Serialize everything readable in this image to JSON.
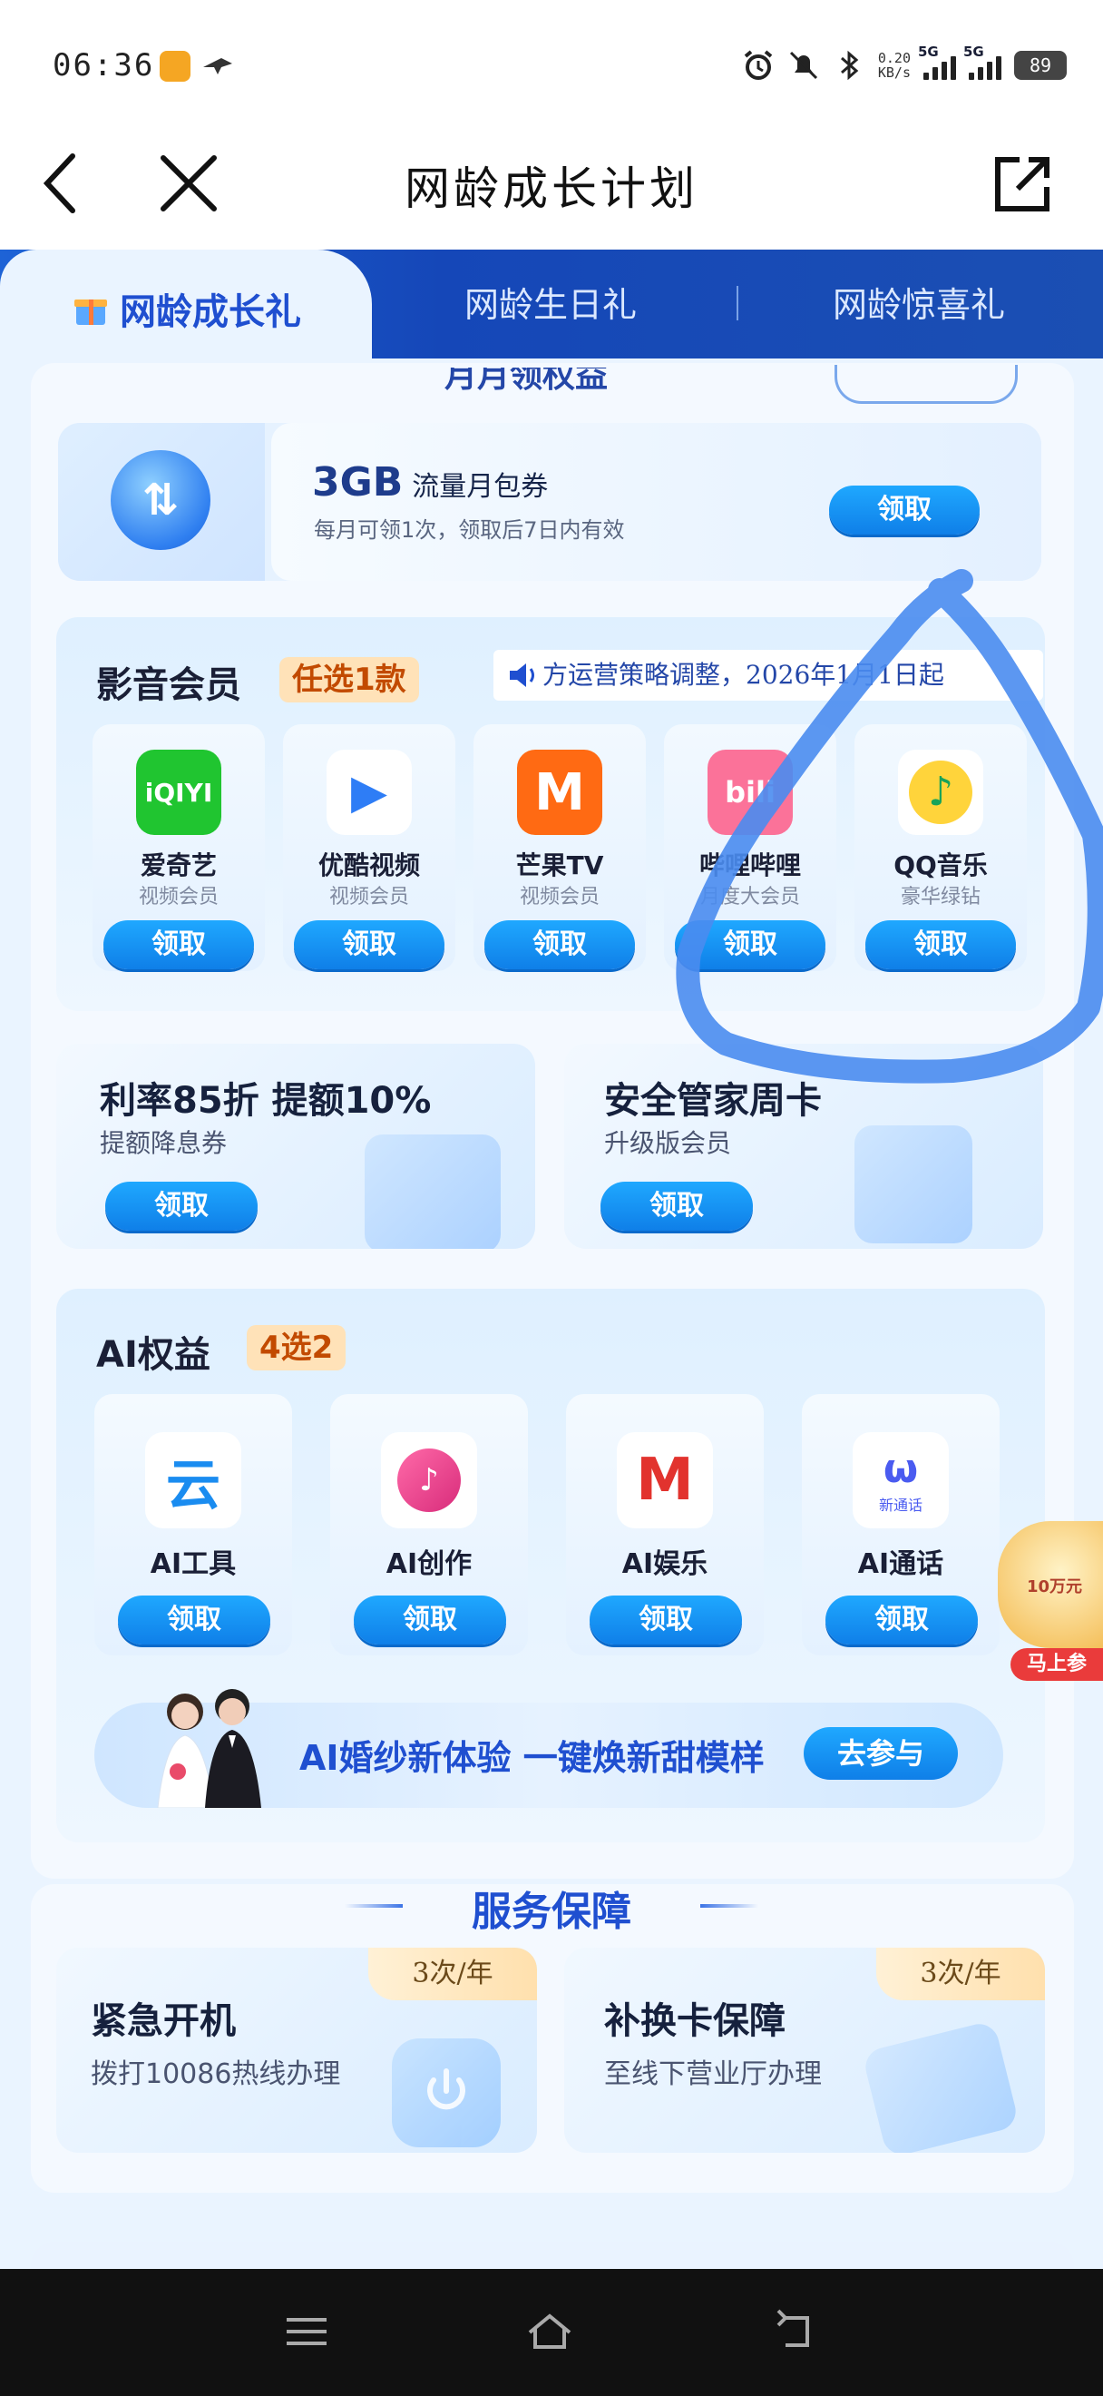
{
  "status_bar": {
    "time": "06:36",
    "net_speed_value": "0.20",
    "net_speed_unit": "KB/s",
    "signal1": "5G",
    "signal2": "5G",
    "battery": "89"
  },
  "nav": {
    "title": "网龄成长计划"
  },
  "tabs": [
    {
      "label": "网龄成长礼",
      "active": true
    },
    {
      "label": "网龄生日礼",
      "active": false
    },
    {
      "label": "网龄惊喜礼",
      "active": false
    }
  ],
  "monthly": {
    "section_title_partial": "月月领权益",
    "flow_amount": "3GB",
    "flow_title": "流量月包券",
    "flow_sub": "每月可领1次，领取后7日内有效",
    "claim": "领取"
  },
  "media": {
    "title": "影音会员",
    "badge": "任选1款",
    "notice": "方运营策略调整，2026年1月1日起",
    "apps": [
      {
        "name": "爱奇艺",
        "sub": "视频会员",
        "logo_text": "iQIYI",
        "color": "#20c530",
        "claim": "领取"
      },
      {
        "name": "优酷视频",
        "sub": "视频会员",
        "logo_text": "▶",
        "color": "#2e7df6",
        "claim": "领取"
      },
      {
        "name": "芒果TV",
        "sub": "视频会员",
        "logo_text": "M",
        "color": "#ff6a13",
        "claim": "领取"
      },
      {
        "name": "哔哩哔哩",
        "sub": "月度大会员",
        "logo_text": "bili",
        "color": "#fb7299",
        "claim": "领取"
      },
      {
        "name": "QQ音乐",
        "sub": "豪华绿钻",
        "logo_text": "♪",
        "color": "#ffd43b",
        "claim": "领取"
      }
    ]
  },
  "promos": [
    {
      "title": "利率85折 提额10%",
      "sub": "提额降息券",
      "claim": "领取"
    },
    {
      "title": "安全管家周卡",
      "sub": "升级版会员",
      "claim": "领取"
    }
  ],
  "ai": {
    "title": "AI权益",
    "badge": "4选2",
    "items": [
      {
        "name": "AI工具",
        "claim": "领取"
      },
      {
        "name": "AI创作",
        "claim": "领取"
      },
      {
        "name": "AI娱乐",
        "claim": "领取"
      },
      {
        "name": "AI通话",
        "claim": "领取",
        "logo_caption": "新通话"
      }
    ],
    "wedding": {
      "text": "AI婚纱新体验 一键焕新甜模样",
      "button": "去参与"
    }
  },
  "float_gift": {
    "line": "10万元",
    "button": "马上参"
  },
  "service": {
    "title": "服务保障",
    "items": [
      {
        "name": "紧急开机",
        "sub": "拨打10086热线办理",
        "tag": "3次/年"
      },
      {
        "name": "补换卡保障",
        "sub": "至线下营业厅办理",
        "tag": "3次/年"
      }
    ]
  },
  "colors": {
    "primary": "#1f4fd0",
    "button": "#0f7fe8",
    "annotation": "#4a8cf0"
  }
}
